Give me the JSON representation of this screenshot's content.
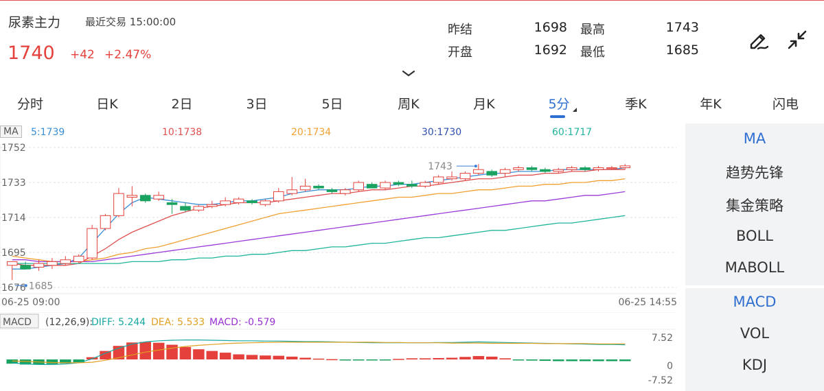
{
  "header": {
    "title": "尿素主力",
    "recent_trade_label": "最近交易",
    "recent_trade_time": "15:00:00",
    "price": "1740",
    "change": "+42",
    "change_pct": "+2.47%",
    "stats": {
      "prev_close_label": "昨结",
      "prev_close": "1698",
      "high_label": "最高",
      "high": "1743",
      "open_label": "开盘",
      "open": "1692",
      "low_label": "最低",
      "low": "1685"
    },
    "icons": {
      "draw": "pen-draw-icon",
      "collapse": "collapse-arrows-icon",
      "chevron": "chevron-down-icon"
    },
    "colors": {
      "up": "#e5413c",
      "down": "#1aa260",
      "accent": "#2f6fd1"
    }
  },
  "tabs": [
    "分时",
    "日K",
    "2日",
    "3日",
    "5日",
    "周K",
    "月K",
    "5分",
    "季K",
    "年K",
    "闪电"
  ],
  "active_tab": "5分",
  "ma_legend": {
    "badge": "MA",
    "items": [
      {
        "label": "5:1739",
        "color": "#3a8fd6"
      },
      {
        "label": "10:1738",
        "color": "#e05050"
      },
      {
        "label": "20:1734",
        "color": "#f0a030"
      },
      {
        "label": "30:1730",
        "color": "#2f4fb0"
      },
      {
        "label": "60:1717",
        "color": "#1fb59a"
      }
    ]
  },
  "price_axis": {
    "labels": [
      "1752",
      "1733",
      "1714",
      "1695",
      "1676"
    ],
    "min": 1676,
    "max": 1752
  },
  "annotations": {
    "high_label": "1743",
    "low_label": "1685"
  },
  "time_axis": {
    "start": "06-25 09:00",
    "end": "06-25 14:55"
  },
  "macd": {
    "badge": "MACD",
    "params": "(12,26,9):",
    "diff_label": "DIFF: 5.244",
    "dea_label": "DEA: 5.533",
    "macd_label": "MACD: -0.579",
    "axis": [
      "7.52",
      "0",
      "-7.52"
    ]
  },
  "side_panel": {
    "main_items": [
      "MA",
      "趋势先锋",
      "集金策略",
      "BOLL",
      "MABOLL"
    ],
    "sub_items": [
      "MACD",
      "VOL",
      "KDJ"
    ],
    "active_main": "MA",
    "active_sub": "MACD"
  },
  "chart_data": {
    "type": "candlestick",
    "interval": "5分",
    "candles": [
      {
        "o": 1688,
        "h": 1690,
        "l": 1680,
        "c": 1690
      },
      {
        "o": 1688,
        "h": 1690,
        "l": 1686,
        "c": 1686
      },
      {
        "o": 1687,
        "h": 1691,
        "l": 1685,
        "c": 1689
      },
      {
        "o": 1688,
        "h": 1692,
        "l": 1686,
        "c": 1690
      },
      {
        "o": 1689,
        "h": 1693,
        "l": 1688,
        "c": 1691
      },
      {
        "o": 1690,
        "h": 1694,
        "l": 1689,
        "c": 1693
      },
      {
        "o": 1692,
        "h": 1710,
        "l": 1691,
        "c": 1708
      },
      {
        "o": 1708,
        "h": 1716,
        "l": 1707,
        "c": 1715
      },
      {
        "o": 1715,
        "h": 1730,
        "l": 1714,
        "c": 1727
      },
      {
        "o": 1725,
        "h": 1731,
        "l": 1720,
        "c": 1726
      },
      {
        "o": 1726,
        "h": 1727,
        "l": 1722,
        "c": 1723
      },
      {
        "o": 1724,
        "h": 1728,
        "l": 1723,
        "c": 1726
      },
      {
        "o": 1722,
        "h": 1724,
        "l": 1716,
        "c": 1721
      },
      {
        "o": 1720,
        "h": 1722,
        "l": 1717,
        "c": 1718
      },
      {
        "o": 1718,
        "h": 1721,
        "l": 1717,
        "c": 1720
      },
      {
        "o": 1720,
        "h": 1723,
        "l": 1719,
        "c": 1721
      },
      {
        "o": 1721,
        "h": 1725,
        "l": 1720,
        "c": 1723
      },
      {
        "o": 1722,
        "h": 1725,
        "l": 1721,
        "c": 1724
      },
      {
        "o": 1723,
        "h": 1724,
        "l": 1721,
        "c": 1722
      },
      {
        "o": 1721,
        "h": 1724,
        "l": 1720,
        "c": 1723
      },
      {
        "o": 1723,
        "h": 1730,
        "l": 1722,
        "c": 1728
      },
      {
        "o": 1727,
        "h": 1736,
        "l": 1726,
        "c": 1729
      },
      {
        "o": 1729,
        "h": 1735,
        "l": 1728,
        "c": 1731
      },
      {
        "o": 1731,
        "h": 1732,
        "l": 1729,
        "c": 1730
      },
      {
        "o": 1729,
        "h": 1730,
        "l": 1727,
        "c": 1728
      },
      {
        "o": 1727,
        "h": 1730,
        "l": 1726,
        "c": 1729
      },
      {
        "o": 1729,
        "h": 1734,
        "l": 1728,
        "c": 1733
      },
      {
        "o": 1732,
        "h": 1733,
        "l": 1730,
        "c": 1730
      },
      {
        "o": 1730,
        "h": 1734,
        "l": 1729,
        "c": 1733
      },
      {
        "o": 1733,
        "h": 1734,
        "l": 1731,
        "c": 1732
      },
      {
        "o": 1732,
        "h": 1734,
        "l": 1730,
        "c": 1731
      },
      {
        "o": 1731,
        "h": 1734,
        "l": 1730,
        "c": 1733
      },
      {
        "o": 1733,
        "h": 1737,
        "l": 1732,
        "c": 1736
      },
      {
        "o": 1735,
        "h": 1739,
        "l": 1734,
        "c": 1736
      },
      {
        "o": 1735,
        "h": 1739,
        "l": 1734,
        "c": 1738
      },
      {
        "o": 1738,
        "h": 1743,
        "l": 1737,
        "c": 1740
      },
      {
        "o": 1739,
        "h": 1740,
        "l": 1736,
        "c": 1737
      },
      {
        "o": 1738,
        "h": 1741,
        "l": 1736,
        "c": 1740
      },
      {
        "o": 1740,
        "h": 1742,
        "l": 1739,
        "c": 1741
      },
      {
        "o": 1741,
        "h": 1742,
        "l": 1739,
        "c": 1740
      },
      {
        "o": 1740,
        "h": 1741,
        "l": 1738,
        "c": 1739
      },
      {
        "o": 1739,
        "h": 1741,
        "l": 1738,
        "c": 1740
      },
      {
        "o": 1740,
        "h": 1742,
        "l": 1739,
        "c": 1741
      },
      {
        "o": 1741,
        "h": 1742,
        "l": 1739,
        "c": 1740
      },
      {
        "o": 1740,
        "h": 1742,
        "l": 1739,
        "c": 1741
      },
      {
        "o": 1741,
        "h": 1742,
        "l": 1740,
        "c": 1741
      },
      {
        "o": 1741,
        "h": 1743,
        "l": 1740,
        "c": 1742
      }
    ],
    "ma_series": [
      {
        "name": "5",
        "color": "#3a8fd6",
        "values": [
          1686,
          1686,
          1687,
          1688,
          1689,
          1692,
          1700,
          1708,
          1716,
          1722,
          1725,
          1724,
          1723,
          1722,
          1721,
          1721,
          1722,
          1723,
          1723,
          1724,
          1725,
          1727,
          1728,
          1729,
          1729,
          1729,
          1730,
          1731,
          1731,
          1732,
          1732,
          1733,
          1734,
          1735,
          1736,
          1737,
          1738,
          1738,
          1739,
          1739,
          1739,
          1740,
          1740,
          1740,
          1740,
          1740,
          1741
        ]
      },
      {
        "name": "10",
        "color": "#e05050",
        "values": [
          1689,
          1688,
          1688,
          1688,
          1688,
          1689,
          1693,
          1697,
          1702,
          1706,
          1709,
          1712,
          1715,
          1717,
          1719,
          1720,
          1721,
          1722,
          1722,
          1722,
          1723,
          1724,
          1725,
          1726,
          1727,
          1727,
          1728,
          1729,
          1729,
          1730,
          1731,
          1731,
          1732,
          1733,
          1734,
          1735,
          1735,
          1736,
          1737,
          1737,
          1738,
          1738,
          1739,
          1739,
          1740,
          1740,
          1740
        ]
      },
      {
        "name": "20",
        "color": "#f0a030",
        "values": [
          1693,
          1692,
          1691,
          1690,
          1690,
          1690,
          1691,
          1692,
          1694,
          1695,
          1697,
          1698,
          1700,
          1702,
          1704,
          1706,
          1708,
          1710,
          1712,
          1714,
          1716,
          1717,
          1718,
          1719,
          1720,
          1721,
          1722,
          1723,
          1724,
          1725,
          1725,
          1726,
          1727,
          1727,
          1728,
          1729,
          1729,
          1730,
          1731,
          1731,
          1732,
          1732,
          1733,
          1733,
          1734,
          1734,
          1735
        ]
      },
      {
        "name": "30",
        "color": "#9a3ad8",
        "values": [
          1691,
          1691,
          1690,
          1690,
          1690,
          1690,
          1690,
          1691,
          1692,
          1693,
          1694,
          1695,
          1696,
          1697,
          1698,
          1699,
          1700,
          1701,
          1702,
          1703,
          1704,
          1705,
          1706,
          1707,
          1708,
          1709,
          1710,
          1711,
          1712,
          1713,
          1714,
          1715,
          1716,
          1717,
          1718,
          1719,
          1720,
          1721,
          1722,
          1723,
          1723,
          1724,
          1725,
          1726,
          1726,
          1727,
          1728
        ]
      },
      {
        "name": "60",
        "color": "#1fb59a",
        "values": [
          1689,
          1689,
          1689,
          1689,
          1689,
          1689,
          1689,
          1689,
          1689,
          1690,
          1690,
          1690,
          1691,
          1691,
          1692,
          1692,
          1693,
          1693,
          1694,
          1694,
          1695,
          1696,
          1696,
          1697,
          1698,
          1698,
          1699,
          1700,
          1700,
          1701,
          1702,
          1703,
          1703,
          1704,
          1705,
          1706,
          1707,
          1707,
          1708,
          1709,
          1710,
          1711,
          1711,
          1712,
          1713,
          1714,
          1715
        ]
      }
    ],
    "macd_hist": [
      -1.5,
      -1.8,
      -1.8,
      -1.6,
      -1.4,
      -1.0,
      0.8,
      3.0,
      4.8,
      6.0,
      6.2,
      5.9,
      5.2,
      4.4,
      3.6,
      3.0,
      2.4,
      1.8,
      1.6,
      1.4,
      1.3,
      1.0,
      0.6,
      0.3,
      0.1,
      -0.1,
      -0.2,
      -0.2,
      -0.1,
      0.2,
      0.4,
      0.4,
      0.5,
      0.6,
      0.9,
      1.2,
      1.0,
      0.4,
      -0.2,
      -0.4,
      -0.5,
      -0.6,
      -0.6,
      -0.6,
      -0.6,
      -0.6,
      -0.6
    ],
    "diff_values": [
      -1.2,
      -1.6,
      -1.8,
      -1.8,
      -1.6,
      -1.2,
      0.2,
      2.2,
      4.0,
      5.4,
      6.2,
      6.6,
      6.8,
      6.9,
      6.9,
      6.8,
      6.7,
      6.6,
      6.6,
      6.5,
      6.5,
      6.4,
      6.3,
      6.3,
      6.2,
      6.1,
      6.0,
      5.9,
      5.9,
      5.9,
      5.9,
      5.9,
      6.0,
      6.0,
      6.1,
      6.2,
      6.1,
      6.0,
      5.9,
      5.8,
      5.7,
      5.6,
      5.5,
      5.4,
      5.3,
      5.3,
      5.2
    ],
    "dea_values": [
      -0.5,
      -0.7,
      -0.9,
      -1.1,
      -1.2,
      -1.2,
      -1.0,
      -0.3,
      0.6,
      1.6,
      2.6,
      3.3,
      4.0,
      4.6,
      5.0,
      5.3,
      5.6,
      5.8,
      5.9,
      6.0,
      6.1,
      6.1,
      6.1,
      6.1,
      6.1,
      6.1,
      6.1,
      6.1,
      6.0,
      6.0,
      5.9,
      5.9,
      5.9,
      5.8,
      5.8,
      5.8,
      5.7,
      5.7,
      5.7,
      5.7,
      5.6,
      5.6,
      5.6,
      5.6,
      5.5,
      5.5,
      5.5
    ],
    "price_range": [
      1676,
      1752
    ],
    "macd_range": [
      -7.52,
      7.52
    ]
  }
}
